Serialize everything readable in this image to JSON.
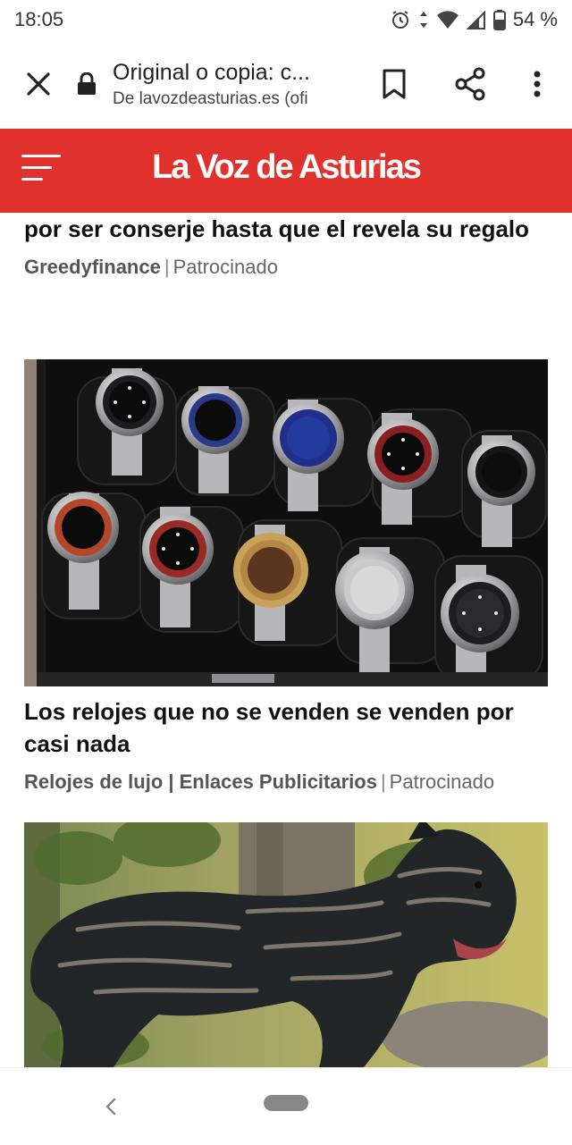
{
  "status_bar": {
    "time": "18:05",
    "battery": "54 %"
  },
  "browser": {
    "page_title": "Original o copia: c...",
    "page_domain": "De lavozdeasturias.es (ofi"
  },
  "site": {
    "logo_text": "La Voz de Asturias",
    "brand_color": "#e0312d"
  },
  "articles": [
    {
      "headline": "La familia de la novia se ríe del padre del novio por ser conserje hasta que el revela su regalo",
      "source": "Greedyfinance",
      "label": "Patrocinado"
    },
    {
      "headline": "Los relojes que no se venden se venden por casi nada",
      "source": "Relojes de lujo | Enlaces Publicitarios",
      "label": "Patrocinado"
    }
  ],
  "icons": {
    "close": "close-icon",
    "lock": "lock-icon",
    "bookmark": "bookmark-icon",
    "share": "share-icon",
    "menu": "more-vert-icon",
    "hamburger": "hamburger-menu-icon"
  }
}
